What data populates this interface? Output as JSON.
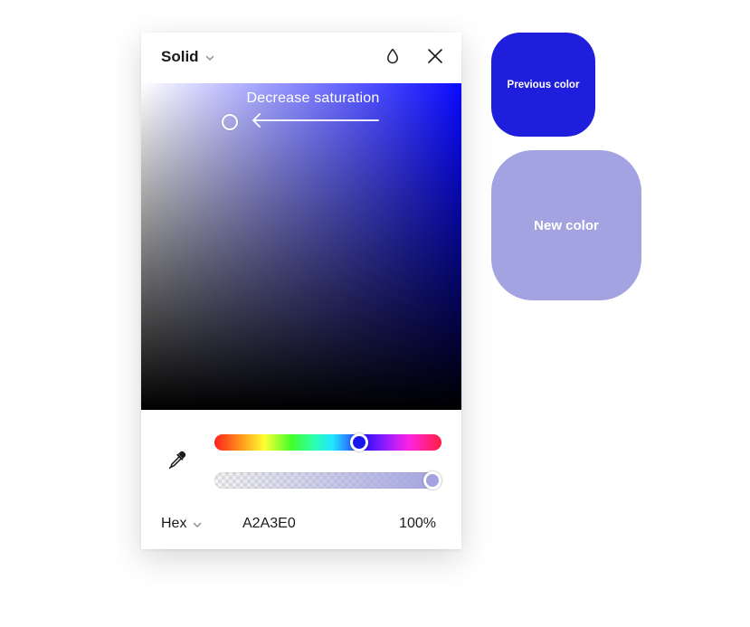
{
  "picker": {
    "fill_type": "Solid",
    "saturation_hint": "Decrease saturation",
    "hue_position": 0.65,
    "alpha_position": 1.0,
    "format": "Hex",
    "hex": "A2A3E0",
    "opacity": "100%"
  },
  "swatches": {
    "previous": {
      "label": "Previous color",
      "color": "#1e1edc"
    },
    "new": {
      "label": "New color",
      "color": "#a2a3e0"
    }
  },
  "icons": {
    "fill_type_chevron": "chevron-down-icon",
    "styles": "droplet-icon",
    "close": "close-icon",
    "eyedropper": "eyedropper-icon",
    "format_chevron": "chevron-down-icon"
  }
}
